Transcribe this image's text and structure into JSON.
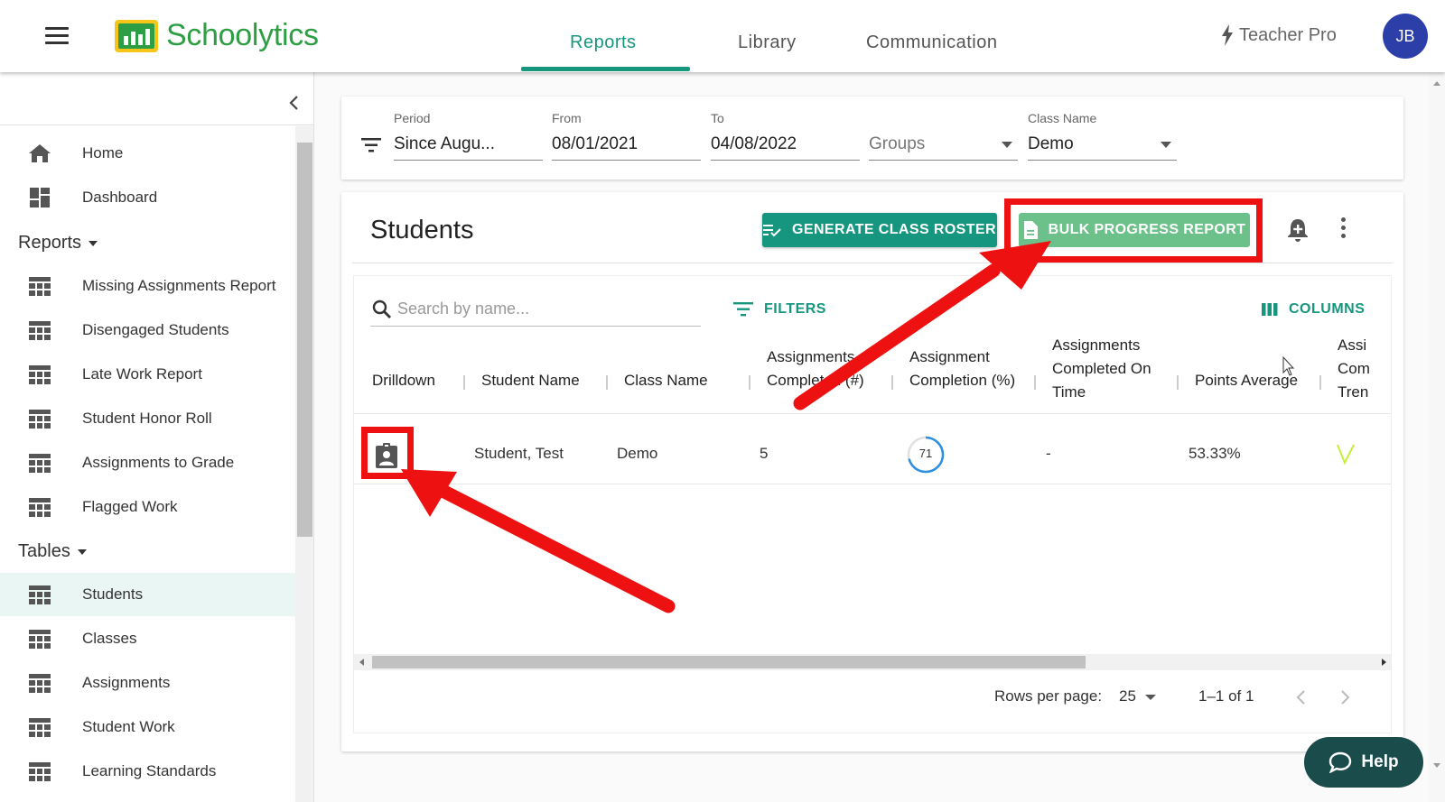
{
  "app": {
    "name": "Schoolytics",
    "brand_color": "#2e9e44",
    "accent_color": "#16967f"
  },
  "nav": {
    "tabs": [
      {
        "label": "Reports",
        "active": true
      },
      {
        "label": "Library",
        "active": false
      },
      {
        "label": "Communication",
        "active": false
      }
    ],
    "plan_label": "Teacher Pro",
    "avatar_initials": "JB"
  },
  "sidebar": {
    "top_items": [
      {
        "label": "Home",
        "icon": "home-icon"
      },
      {
        "label": "Dashboard",
        "icon": "dashboard-icon"
      }
    ],
    "reports_header": "Reports",
    "report_items": [
      {
        "label": "Missing Assignments Report",
        "icon": "table-icon"
      },
      {
        "label": "Disengaged Students",
        "icon": "table-icon"
      },
      {
        "label": "Late Work Report",
        "icon": "table-icon"
      },
      {
        "label": "Student Honor Roll",
        "icon": "table-icon"
      },
      {
        "label": "Assignments to Grade",
        "icon": "table-icon"
      },
      {
        "label": "Flagged Work",
        "icon": "table-icon"
      }
    ],
    "tables_header": "Tables",
    "table_items": [
      {
        "label": "Students",
        "icon": "table-icon",
        "active": true
      },
      {
        "label": "Classes",
        "icon": "table-icon"
      },
      {
        "label": "Assignments",
        "icon": "table-icon"
      },
      {
        "label": "Student Work",
        "icon": "table-icon"
      },
      {
        "label": "Learning Standards",
        "icon": "table-icon"
      }
    ]
  },
  "filters": {
    "period_label": "Period",
    "period_value": "Since Augu...",
    "from_label": "From",
    "from_value": "08/01/2021",
    "to_label": "To",
    "to_value": "04/08/2022",
    "groups_value": "Groups",
    "class_label": "Class Name",
    "class_value": "Demo"
  },
  "students": {
    "title": "Students",
    "roster_button": "GENERATE CLASS ROSTER",
    "bulk_button": "BULK PROGRESS REPORT",
    "search_placeholder": "Search by name...",
    "filters_label": "FILTERS",
    "columns_label": "COLUMNS",
    "headers": {
      "drilldown": "Drilldown",
      "student_name": "Student Name",
      "class_name": "Class Name",
      "assign_completed_1": "Assignments",
      "assign_completed_2": "Completed (#)",
      "completion_1": "Assignment",
      "completion_2": "Completion (%)",
      "on_time_1": "Assignments",
      "on_time_2": "Completed On",
      "on_time_3": "Time",
      "points_avg": "Points Average",
      "trend_1": "Assi",
      "trend_2": "Com",
      "trend_3": "Tren"
    },
    "rows": [
      {
        "student_name": "Student, Test",
        "class_name": "Demo",
        "assignments_completed": "5",
        "completion_pct": "71",
        "completion_fraction": 0.71,
        "on_time": "-",
        "points_average": "53.33%"
      }
    ],
    "pagination": {
      "rows_per_page_label": "Rows per page:",
      "rows_per_page_value": "25",
      "range": "1–1 of 1"
    }
  },
  "help": {
    "label": "Help"
  },
  "annotation_color": "#ee1111"
}
